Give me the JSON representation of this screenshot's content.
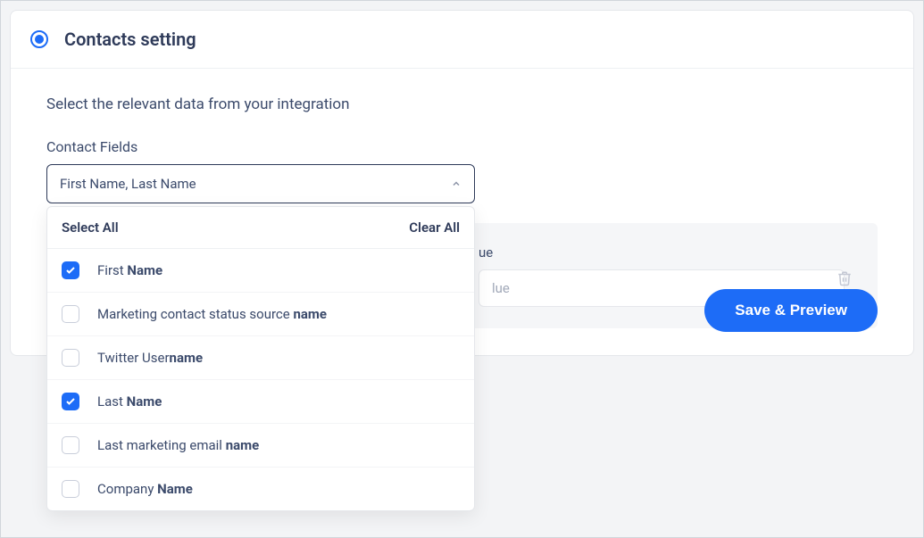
{
  "header": {
    "title": "Contacts setting"
  },
  "body": {
    "instruction": "Select the relevant data from your integration",
    "fieldLabel": "Contact Fields",
    "selectValue": "First Name, Last Name",
    "selectAllLabel": "Select All",
    "clearAllLabel": "Clear All",
    "options": [
      {
        "prefix": "First ",
        "bold": "Name",
        "checked": true
      },
      {
        "prefix": "Marketing contact status source ",
        "bold": "name",
        "checked": false
      },
      {
        "prefix": "Twitter User",
        "bold": "name",
        "checked": false
      },
      {
        "prefix": "Last ",
        "bold": "Name",
        "checked": true
      },
      {
        "prefix": "Last marketing email ",
        "bold": "name",
        "checked": false
      },
      {
        "prefix": "Company ",
        "bold": "Name",
        "checked": false
      }
    ]
  },
  "panel": {
    "valueLabelVisible": "ue",
    "valuePlaceholderVisible": "lue"
  },
  "actions": {
    "saveLabel": "Save & Preview"
  }
}
